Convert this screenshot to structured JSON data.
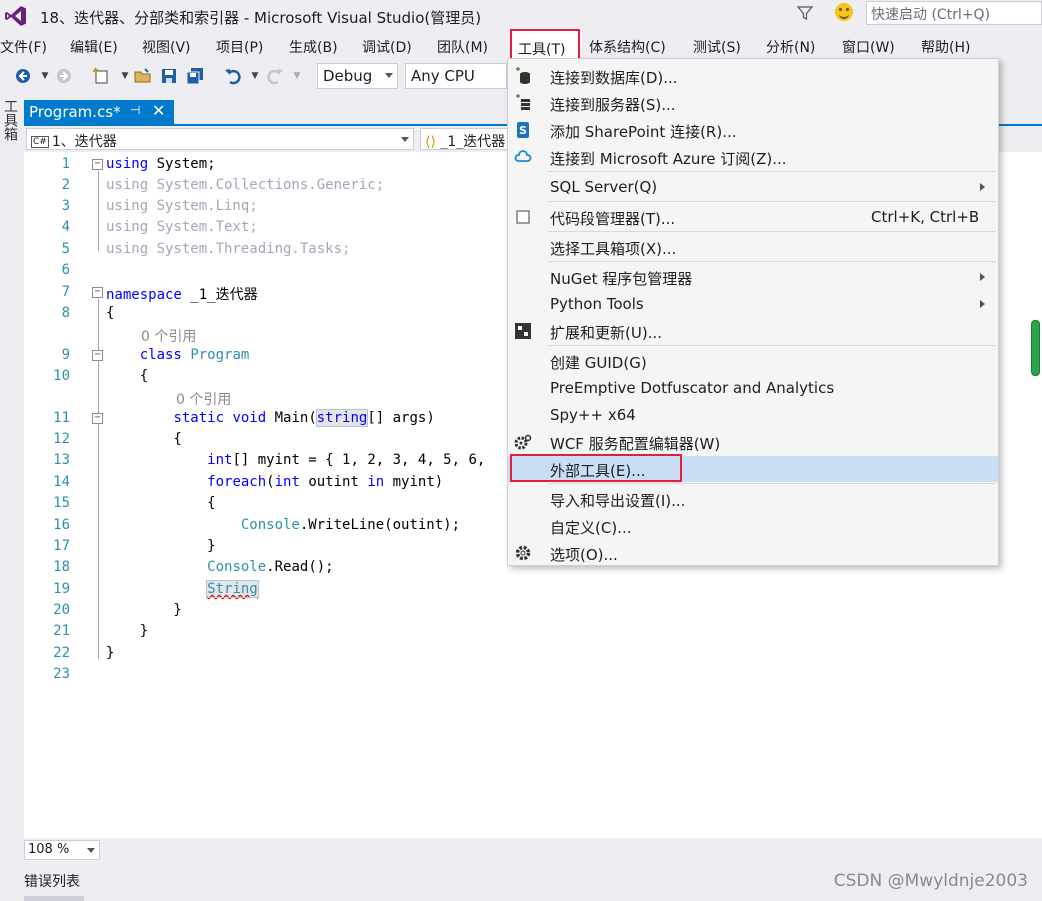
{
  "window": {
    "title": "18、迭代器、分部类和索引器 - Microsoft Visual Studio(管理员)",
    "quick_launch_placeholder": "快速启动 (Ctrl+Q)"
  },
  "menubar": [
    "文件(F)",
    "编辑(E)",
    "视图(V)",
    "项目(P)",
    "生成(B)",
    "调试(D)",
    "团队(M)",
    "工具(T)",
    "体系结构(C)",
    "测试(S)",
    "分析(N)",
    "窗口(W)",
    "帮助(H)"
  ],
  "toolbar": {
    "config": "Debug",
    "platform": "Any CPU"
  },
  "toolbox_rail": "工具箱",
  "doc_tab": {
    "name": "Program.cs*",
    "pin": "⊣",
    "close": "✕"
  },
  "navbar": {
    "project": "1、迭代器",
    "scope": "_1_迭代器"
  },
  "code": {
    "line_numbers": [
      "1",
      "2",
      "3",
      "4",
      "5",
      "6",
      "7",
      "8",
      "9",
      "10",
      "11",
      "12",
      "13",
      "14",
      "15",
      "16",
      "17",
      "18",
      "19",
      "20",
      "21",
      "22",
      "23"
    ],
    "ref_count_1": "0 个引用",
    "ref_count_2": "0 个引用"
  },
  "zoom": "108 %",
  "bottom_tab": "错误列表",
  "watermark": "CSDN @Mwyldnje2003",
  "tools_menu": {
    "items": [
      {
        "label": "连接到数据库(D)...",
        "icon": "database-connect-icon"
      },
      {
        "label": "连接到服务器(S)...",
        "icon": "server-connect-icon"
      },
      {
        "label": "添加 SharePoint 连接(R)...",
        "icon": "sharepoint-icon"
      },
      {
        "label": "连接到 Microsoft Azure 订阅(Z)...",
        "icon": "azure-cloud-icon"
      },
      {
        "label": "SQL Server(Q)",
        "icon": ""
      },
      {
        "label": "代码段管理器(T)...",
        "icon": "checkbox-icon",
        "shortcut": "Ctrl+K, Ctrl+B"
      },
      {
        "label": "选择工具箱项(X)...",
        "icon": ""
      },
      {
        "label": "NuGet 程序包管理器",
        "icon": ""
      },
      {
        "label": "Python Tools",
        "icon": ""
      },
      {
        "label": "扩展和更新(U)...",
        "icon": "extensions-icon"
      },
      {
        "label": "创建 GUID(G)",
        "icon": ""
      },
      {
        "label": "PreEmptive Dotfuscator and Analytics",
        "icon": ""
      },
      {
        "label": "Spy++ x64",
        "icon": ""
      },
      {
        "label": "WCF 服务配置编辑器(W)",
        "icon": "wcf-gear-icon"
      },
      {
        "label": "外部工具(E)...",
        "icon": ""
      },
      {
        "label": "导入和导出设置(I)...",
        "icon": ""
      },
      {
        "label": "自定义(C)...",
        "icon": ""
      },
      {
        "label": "选项(O)...",
        "icon": "gear-icon"
      }
    ]
  },
  "colors": {
    "accent": "#007acc",
    "highlight_box": "#e0203a",
    "hover": "#c9def5"
  }
}
